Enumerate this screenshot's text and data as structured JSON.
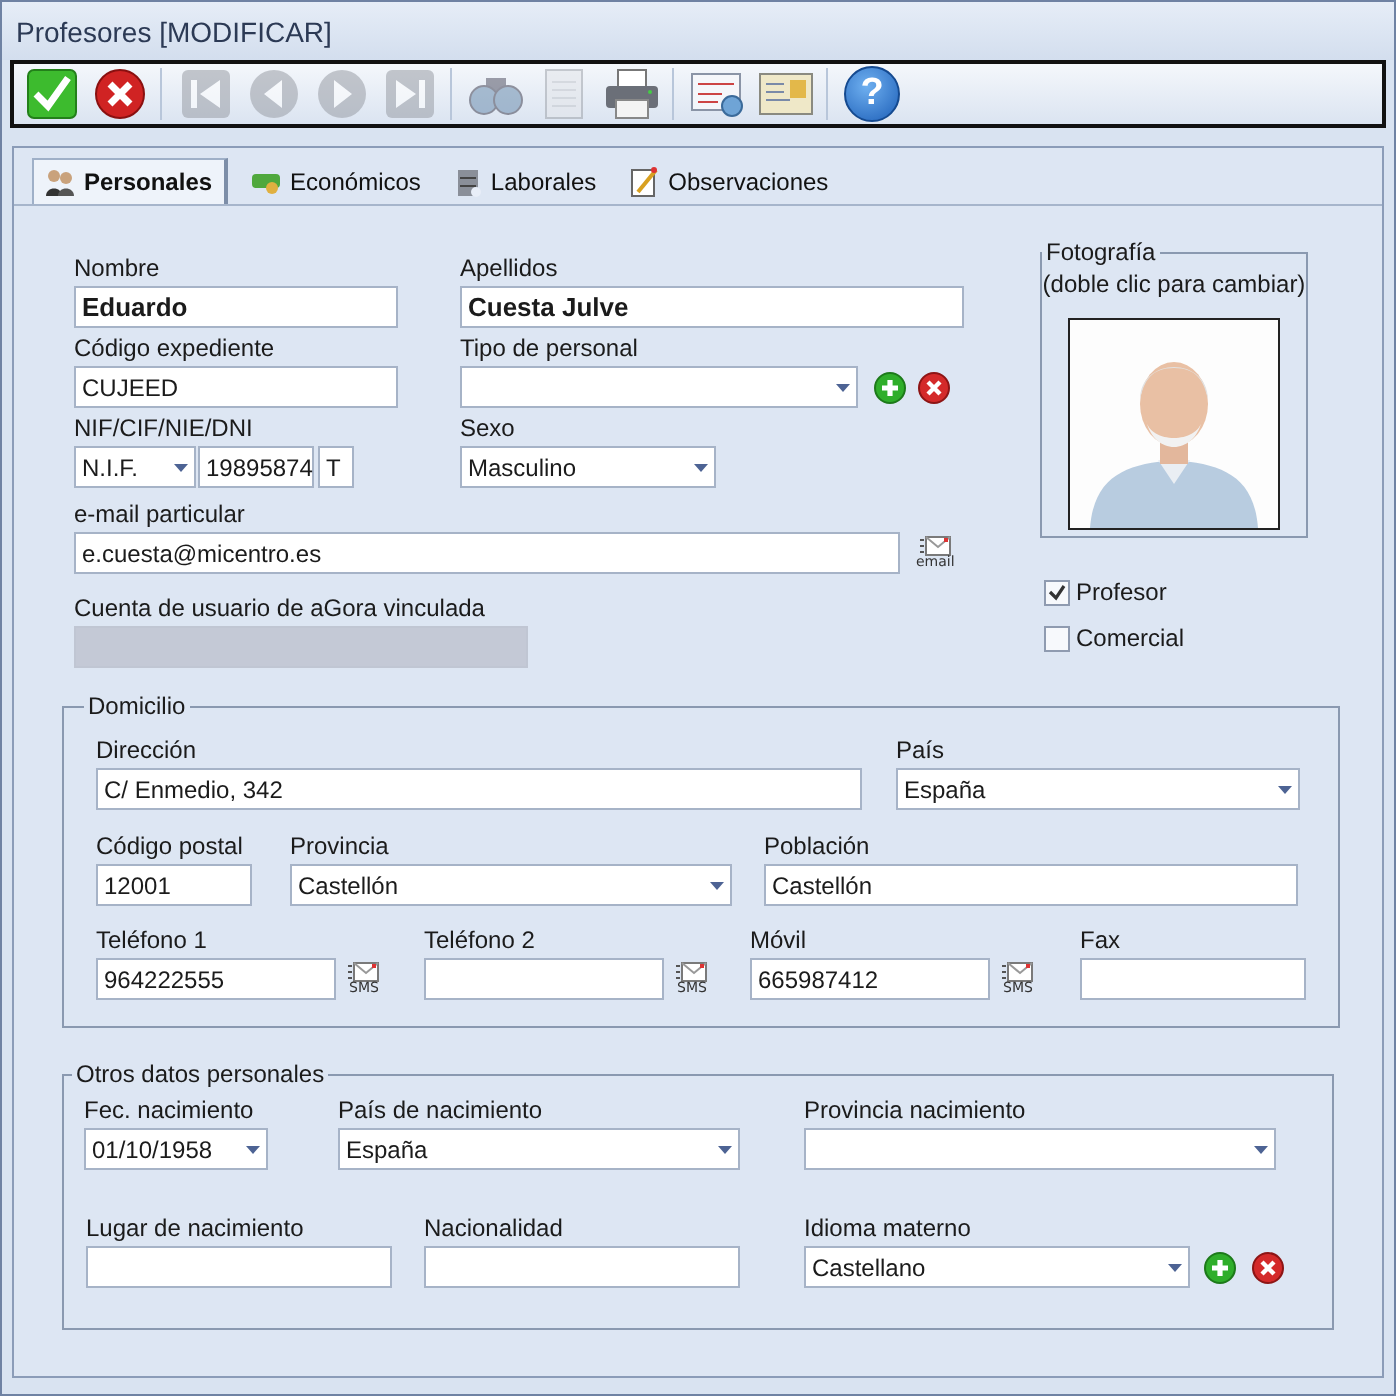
{
  "window": {
    "title": "Profesores [MODIFICAR]"
  },
  "toolbar": {
    "buttons": [
      {
        "kind": "accept",
        "disabled": false
      },
      {
        "kind": "cancel",
        "disabled": false
      },
      {
        "kind": "first",
        "disabled": true
      },
      {
        "kind": "prev",
        "disabled": true
      },
      {
        "kind": "next",
        "disabled": true
      },
      {
        "kind": "last",
        "disabled": true
      },
      {
        "kind": "search",
        "disabled": true
      },
      {
        "kind": "document",
        "disabled": true
      },
      {
        "kind": "print",
        "disabled": false
      },
      {
        "kind": "form",
        "disabled": false
      },
      {
        "kind": "card",
        "disabled": false
      },
      {
        "kind": "help",
        "disabled": false,
        "label": "?"
      }
    ]
  },
  "tabs": [
    {
      "label": "Personales",
      "kind": "people",
      "selected": true
    },
    {
      "label": "Económicos",
      "kind": "money",
      "selected": false
    },
    {
      "label": "Laborales",
      "kind": "cabinet",
      "selected": false
    },
    {
      "label": "Observaciones",
      "kind": "note",
      "selected": false
    }
  ],
  "personal": {
    "nombre": {
      "label": "Nombre",
      "kind": "text",
      "value": "Eduardo",
      "bold": true
    },
    "apellidos": {
      "label": "Apellidos",
      "kind": "text",
      "value": "Cuesta Julve",
      "bold": true
    },
    "codigo": {
      "label": "Código expediente",
      "kind": "text",
      "value": "CUJEED"
    },
    "tipo": {
      "label": "Tipo de personal",
      "kind": "select"
    },
    "documento": {
      "label": "NIF/CIF/NIE/DNI",
      "type": {
        "kind": "select",
        "value": "N.I.F."
      },
      "number": {
        "kind": "text",
        "value": "19895874"
      },
      "letter": {
        "kind": "text",
        "value": "T"
      }
    },
    "sexo": {
      "label": "Sexo",
      "kind": "select",
      "value": "Masculino"
    },
    "email": {
      "label": "e-mail particular",
      "kind": "text",
      "value": "e.cuesta@micentro.es",
      "button": "email"
    },
    "cuenta": {
      "label": "Cuenta de usuario de aGora vinculada",
      "kind": "select",
      "disabled": true
    }
  },
  "photo": {
    "title": "Fotografía",
    "hint": "(doble clic para cambiar)"
  },
  "roles": [
    {
      "label": "Profesor",
      "checked": true
    },
    {
      "label": "Comercial",
      "checked": false
    }
  ],
  "domicilio": {
    "title": "Domicilio",
    "direccion": {
      "label": "Dirección",
      "kind": "text",
      "value": "C/ Enmedio, 342"
    },
    "pais": {
      "label": "País",
      "kind": "select",
      "value": "España"
    },
    "codigo_postal": {
      "label": "Código postal",
      "kind": "text",
      "value": "12001"
    },
    "provincia": {
      "label": "Provincia",
      "kind": "select",
      "value": "Castellón"
    },
    "poblacion": {
      "label": "Población",
      "kind": "text",
      "value": "Castellón"
    },
    "telefono1": {
      "label": "Teléfono 1",
      "kind": "text",
      "value": "964222555",
      "button": "SMS"
    },
    "telefono2": {
      "label": "Teléfono 2",
      "kind": "text",
      "button": "SMS"
    },
    "movil": {
      "label": "Móvil",
      "kind": "text",
      "value": "665987412",
      "button": "SMS"
    },
    "fax": {
      "label": "Fax",
      "kind": "text"
    }
  },
  "otros": {
    "title": "Otros datos personales",
    "nacimiento": {
      "label": "Fec. nacimiento",
      "kind": "select",
      "value": "01/10/1958"
    },
    "pais_nacimiento": {
      "label": "País de nacimiento",
      "kind": "select",
      "value": "España"
    },
    "provincia_nacimiento": {
      "label": "Provincia nacimiento",
      "kind": "select"
    },
    "lugar": {
      "label": "Lugar de nacimiento",
      "kind": "text"
    },
    "nacionalidad": {
      "label": "Nacionalidad",
      "kind": "text"
    },
    "idioma": {
      "label": "Idioma materno",
      "kind": "select",
      "value": "Castellano"
    }
  }
}
